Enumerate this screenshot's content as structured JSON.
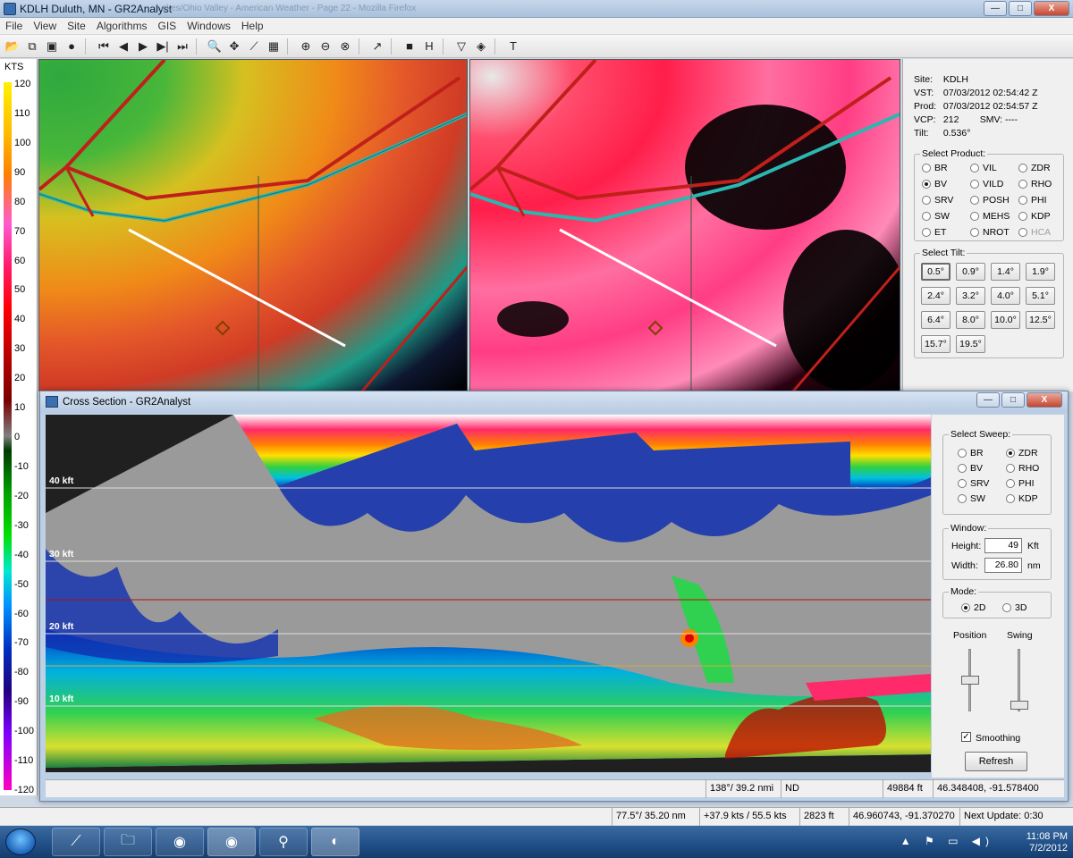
{
  "app": {
    "title": "KDLH Duluth, MN - GR2Analyst",
    "ghost_title": "Lakes/Ohio Valley - American Weather - Page 22 - Mozilla Firefox",
    "window_buttons": {
      "minimize": "—",
      "maximize": "□",
      "close": "X"
    }
  },
  "menu": [
    "File",
    "View",
    "Site",
    "Algorithms",
    "GIS",
    "Windows",
    "Help"
  ],
  "toolbar": {
    "icons": [
      "open-icon",
      "copy-icon",
      "save-icon",
      "record-icon",
      "first-frame-icon",
      "prev-frame-icon",
      "play-icon",
      "next-frame-icon",
      "last-frame-icon",
      "zoom-icon",
      "pan-icon",
      "line-icon",
      "layers-icon",
      "zoom-in-icon",
      "zoom-out-icon",
      "zoom-reset-icon",
      "cross-section-icon",
      "stop-icon",
      "split-icon",
      "filter-icon",
      "target-icon",
      "text-icon"
    ],
    "glyphs": [
      "📂",
      "⧉",
      "▣",
      "●",
      "⏮",
      "◀",
      "▶",
      "▶|",
      "⏭",
      "🔍",
      "✥",
      "⟋",
      "▦",
      "⊕",
      "⊖",
      "⊗",
      "↗",
      "■",
      "H",
      "▽",
      "◈",
      "T"
    ]
  },
  "colorbar": {
    "units": "KTS",
    "ticks": [
      "120",
      "110",
      "100",
      "90",
      "80",
      "70",
      "60",
      "50",
      "40",
      "30",
      "20",
      "10",
      "0",
      "-10",
      "-20",
      "-30",
      "-40",
      "-50",
      "-60",
      "-70",
      "-80",
      "-90",
      "-100",
      "-110",
      "-120"
    ]
  },
  "info": {
    "site_label": "Site:",
    "site": "KDLH",
    "vst_label": "VST:",
    "vst": "07/03/2012  02:54:42 Z",
    "prod_label": "Prod:",
    "prod": "07/03/2012  02:54:57 Z",
    "vcp_label": "VCP:",
    "vcp": "212",
    "smv_label": "SMV:",
    "smv": "----",
    "tilt_label": "Tilt:",
    "tilt": "0.536°"
  },
  "select_product": {
    "title": "Select Product:",
    "options": [
      {
        "label": "BR",
        "selected": false,
        "enabled": true
      },
      {
        "label": "VIL",
        "selected": false,
        "enabled": true
      },
      {
        "label": "ZDR",
        "selected": false,
        "enabled": true
      },
      {
        "label": "BV",
        "selected": true,
        "enabled": true
      },
      {
        "label": "VILD",
        "selected": false,
        "enabled": true
      },
      {
        "label": "RHO",
        "selected": false,
        "enabled": true
      },
      {
        "label": "SRV",
        "selected": false,
        "enabled": true
      },
      {
        "label": "POSH",
        "selected": false,
        "enabled": true
      },
      {
        "label": "PHI",
        "selected": false,
        "enabled": true
      },
      {
        "label": "SW",
        "selected": false,
        "enabled": true
      },
      {
        "label": "MEHS",
        "selected": false,
        "enabled": true
      },
      {
        "label": "KDP",
        "selected": false,
        "enabled": true
      },
      {
        "label": "ET",
        "selected": false,
        "enabled": true
      },
      {
        "label": "NROT",
        "selected": false,
        "enabled": true
      },
      {
        "label": "HCA",
        "selected": false,
        "enabled": false
      }
    ]
  },
  "select_tilt": {
    "title": "Select Tilt:",
    "options": [
      "0.5°",
      "0.9°",
      "1.4°",
      "1.9°",
      "2.4°",
      "3.2°",
      "4.0°",
      "5.1°",
      "6.4°",
      "8.0°",
      "10.0°",
      "12.5°",
      "15.7°",
      "19.5°"
    ],
    "selected": "0.5°"
  },
  "cross_section": {
    "title": "Cross Section - GR2Analyst",
    "altitude_labels": [
      "40 kft",
      "30 kft",
      "20 kft",
      "10 kft"
    ],
    "select_sweep": {
      "title": "Select Sweep:",
      "options": [
        {
          "label": "BR",
          "selected": false
        },
        {
          "label": "ZDR",
          "selected": true
        },
        {
          "label": "BV",
          "selected": false
        },
        {
          "label": "RHO",
          "selected": false
        },
        {
          "label": "SRV",
          "selected": false
        },
        {
          "label": "PHI",
          "selected": false
        },
        {
          "label": "SW",
          "selected": false
        },
        {
          "label": "KDP",
          "selected": false
        }
      ]
    },
    "window": {
      "title": "Window:",
      "height_label": "Height:",
      "height_value": "49",
      "height_unit": "Kft",
      "width_label": "Width:",
      "width_value": "26.80",
      "width_unit": "nm"
    },
    "mode": {
      "title": "Mode:",
      "options": [
        {
          "label": "2D",
          "selected": true
        },
        {
          "label": "3D",
          "selected": false
        }
      ]
    },
    "position_label": "Position",
    "swing_label": "Swing",
    "smoothing_label": "Smoothing",
    "smoothing_checked": true,
    "refresh_label": "Refresh",
    "status": [
      "138°/ 39.2 nmi",
      "ND",
      "49884 ft",
      "46.348408, -91.578400"
    ]
  },
  "status": [
    "77.5°/ 35.20 nm",
    "+37.9 kts / 55.5 kts",
    "2823 ft",
    "46.960743, -91.370270",
    "Next Update: 0:30"
  ],
  "taskbar": {
    "apps": [
      "GR2Analyst",
      "Windows Explorer",
      "Firefox",
      "Firefox",
      "Search",
      "Radar"
    ],
    "time": "11:08 PM",
    "date": "7/2/2012"
  }
}
